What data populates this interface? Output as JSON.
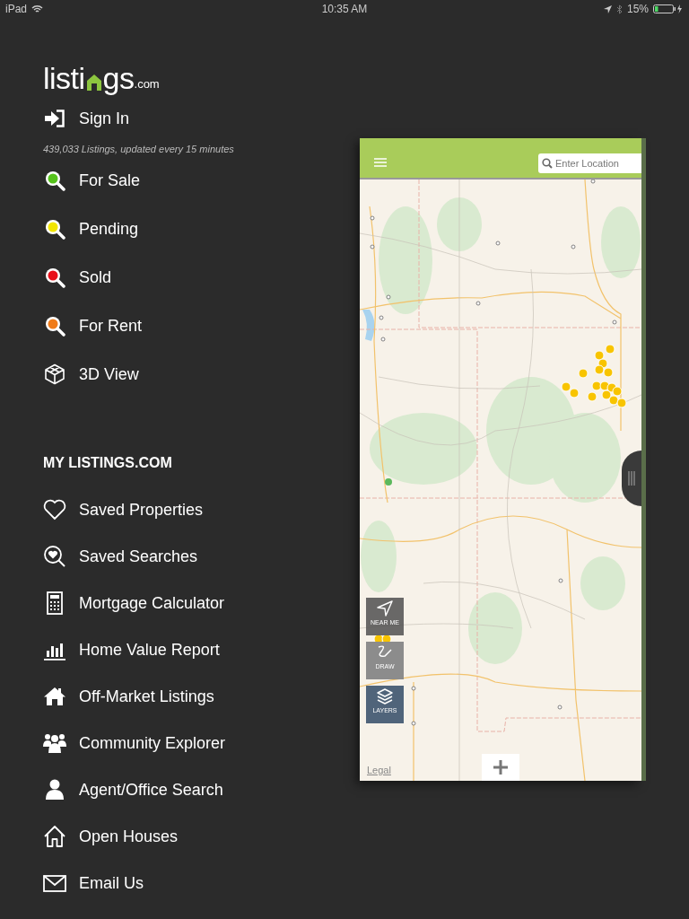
{
  "status_bar": {
    "device": "iPad",
    "time": "10:35 AM",
    "battery": "15%"
  },
  "logo": {
    "before": "listi",
    "after": "gs",
    "suffix": ".com"
  },
  "sign_in": {
    "label": "Sign In"
  },
  "listing_count": "439,033 Listings, updated every 15 minutes",
  "search_items": [
    {
      "kind": "status",
      "label": "For Sale",
      "color": "#55c21b"
    },
    {
      "kind": "status",
      "label": "Pending",
      "color": "#f2e600"
    },
    {
      "kind": "status",
      "label": "Sold",
      "color": "#e8101a"
    },
    {
      "kind": "status",
      "label": "For Rent",
      "color": "#f07c1a"
    },
    {
      "kind": "view",
      "label": "3D View"
    }
  ],
  "section_heading": "MY LISTINGS.COM",
  "my_items": [
    {
      "label": "Saved Properties"
    },
    {
      "label": "Saved Searches"
    },
    {
      "label": "Mortgage Calculator"
    },
    {
      "label": "Home Value Report"
    },
    {
      "label": "Off-Market Listings"
    },
    {
      "label": "Community Explorer"
    },
    {
      "label": "Agent/Office Search"
    },
    {
      "label": "Open Houses"
    },
    {
      "label": "Email Us"
    }
  ],
  "map_panel": {
    "search": {
      "placeholder": "Enter Location"
    },
    "tools": [
      {
        "label": "NEAR ME",
        "kind": "near"
      },
      {
        "label": "DRAW",
        "kind": "draw"
      },
      {
        "label": "LAYERS",
        "kind": "layers"
      }
    ],
    "legal": "Legal"
  }
}
